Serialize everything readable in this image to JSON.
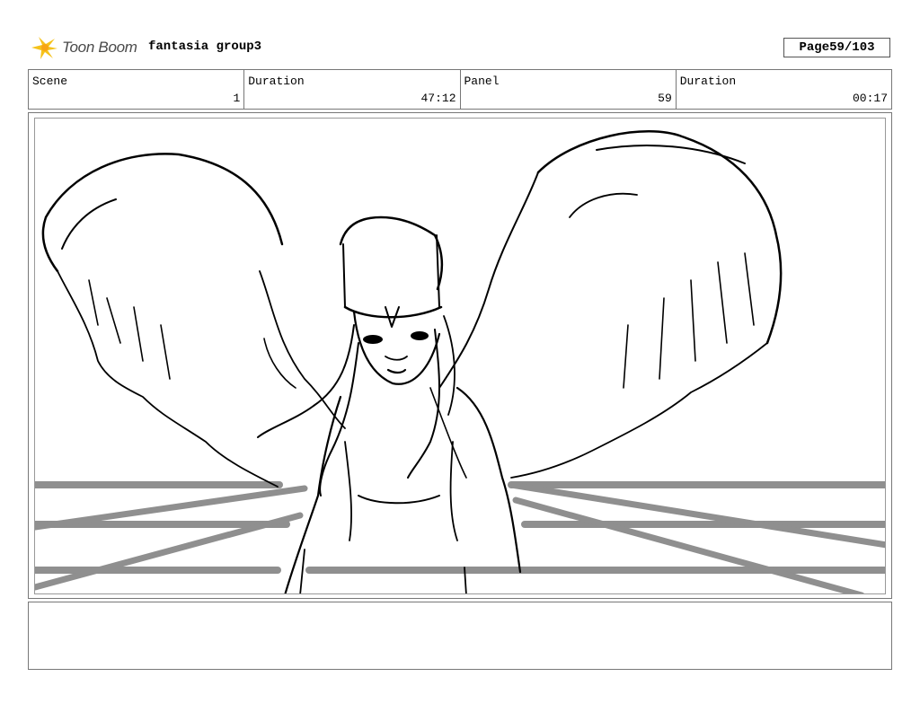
{
  "header": {
    "brand": "Toon Boom",
    "project_title": "fantasia group3",
    "page_label": "Page",
    "page_value": "59/103"
  },
  "info_cells": [
    {
      "label": "Scene",
      "value": "1"
    },
    {
      "label": "Duration",
      "value": "47:12"
    },
    {
      "label": "Panel",
      "value": "59"
    },
    {
      "label": "Duration",
      "value": "00:17"
    }
  ],
  "panel": {
    "image": "sketch of a winged figure with a headband standing in front of a boxing ring's ropes"
  },
  "notes": {
    "text": ""
  },
  "colors": {
    "rope": "#8f8f8f",
    "ink": "#000000",
    "logo_star": "#f5c21a"
  }
}
